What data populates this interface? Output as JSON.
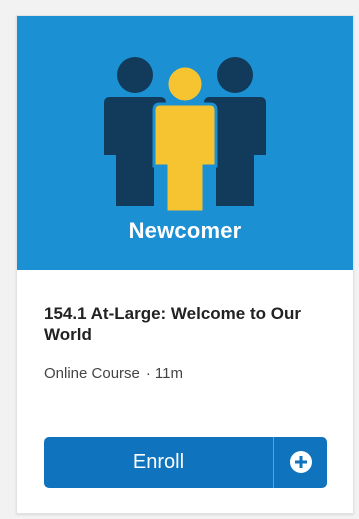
{
  "hero": {
    "label": "Newcomer",
    "icon": "people-group-icon",
    "background_color": "#1b90d2"
  },
  "course": {
    "title": "154.1 At-Large: Welcome to Our World",
    "type": "Online Course",
    "separator": "·",
    "duration": "11m"
  },
  "actions": {
    "enroll_label": "Enroll",
    "add_icon": "plus-circle-icon",
    "button_color": "#0f73bd"
  }
}
